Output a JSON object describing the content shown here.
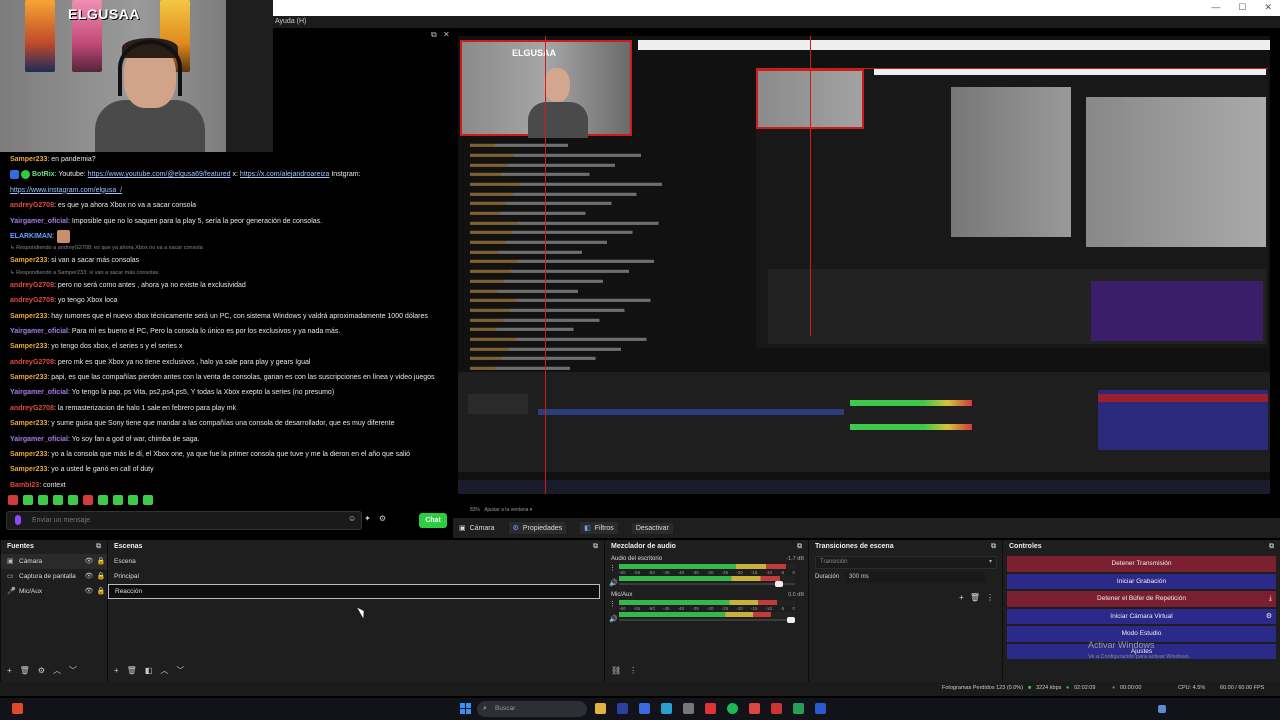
{
  "window": {
    "menu_help": "Ayuda (H)",
    "minimize": "—",
    "maximize": "☐",
    "close": "✕"
  },
  "webcam": {
    "logo": "ELGUSAA"
  },
  "chat": {
    "messages": [
      {
        "user": "Samper233",
        "text": ": en pandemia?",
        "user_color": "orange",
        "small": false
      },
      {
        "user": "BotRix",
        "text": ": Youtube: ",
        "link1": "https://www.youtube.com/@elgusa69/featured",
        "mid": " x: ",
        "link2": "https://x.com/alejandroareiza",
        "tail": " Instgram:",
        "user_color": "green",
        "small": false,
        "kind": "links"
      },
      {
        "user": "",
        "text": "",
        "link1": "https://www.instagram.com/elgusa_/",
        "user_color": "green",
        "small": false,
        "kind": "link_only"
      },
      {
        "user": "andreyG2708",
        "text": ": es que ya ahora Xbox no va a sacar consola",
        "user_color": "red",
        "small": false
      },
      {
        "user": "Yairgamer_oficial",
        "text": ": Imposible que no lo saquen para la play 5, sería la peor generación de consolas.",
        "user_color": "purple",
        "small": false
      },
      {
        "user": "ELARKIMAN",
        "text": ":",
        "user_color": "blue",
        "small": false,
        "emote": true
      },
      {
        "user": "",
        "text": "↳ Respondiendo a andreyG2708: es que ya ahora Xbox no va a sacar consola",
        "user_color": "grey",
        "small": true
      },
      {
        "user": "Samper233",
        "text": ": si van a sacar más consolas",
        "user_color": "orange",
        "small": false
      },
      {
        "user": "",
        "text": "↳ Respondiendo a Samper233: si van a sacar más consolas",
        "user_color": "grey",
        "small": true
      },
      {
        "user": "andreyG2708",
        "text": ": pero no será como antes , ahora ya no existe la exclusividad",
        "user_color": "red",
        "small": false
      },
      {
        "user": "andreyG2708",
        "text": ": yo tengo Xbox loca",
        "user_color": "red",
        "small": false
      },
      {
        "user": "Samper233",
        "text": ": hay rumores que el nuevo xbox técnicamente será un PC, con sistema Windows y valdrá aproximadamente 1000 dólares",
        "user_color": "orange",
        "small": false
      },
      {
        "user": "Yairgamer_oficial",
        "text": ": Para mí es bueno el PC, Pero la consola lo único es por los exclusivos y ya nada más.",
        "user_color": "purple",
        "small": false
      },
      {
        "user": "Samper233",
        "text": ": yo tengo dos xbox, el series s y el series x",
        "user_color": "orange",
        "small": false
      },
      {
        "user": "andreyG2708",
        "text": ": pero mk es que Xbox ya no tiene exclusivos , halo ya sale para play y gears Igual",
        "user_color": "red",
        "small": false
      },
      {
        "user": "Samper233",
        "text": ": papi, es que las compañías pierden antes con la venta de consolas, ganan es con las suscripciones en línea y video juegos",
        "user_color": "orange",
        "small": false
      },
      {
        "user": "Yairgamer_oficial",
        "text": ": Yo tengo la pap, ps Vita, ps2,ps4,ps5, Y todas la Xbox exepto la series (no presumo)",
        "user_color": "purple",
        "small": false
      },
      {
        "user": "andreyG2708",
        "text": ": la remasterizacion de halo 1 sale en febrero para play mk",
        "user_color": "red",
        "small": false
      },
      {
        "user": "Samper233",
        "text": ": y sume guisa que Sony tiene que mandar a las compañías una consola de desarrollador, que es muy diferente",
        "user_color": "orange",
        "small": false
      },
      {
        "user": "Yairgamer_oficial",
        "text": ": Yo soy fan a god of war, chimba de saga.",
        "user_color": "purple",
        "small": false
      },
      {
        "user": "Samper233",
        "text": ": yo a la consola que más le dí, el Xbox one, ya que fue la primer consola que tuve y me la dieron en el año que salió",
        "user_color": "orange",
        "small": false
      },
      {
        "user": "Samper233",
        "text": ": yo a usted le ganó en call of duty",
        "user_color": "orange",
        "small": false
      },
      {
        "user": "Bambi23",
        "text": ": context",
        "user_color": "red",
        "small": false
      }
    ],
    "input_placeholder": "Enviar un mensaje",
    "send_label": "Chat"
  },
  "toolbar2": {
    "zoom": "83%",
    "fit": "Ajustar a la ventana"
  },
  "source_bar": {
    "source_name": "Cámara",
    "properties": "Propiedades",
    "filters": "Filtros",
    "deactivate": "Desactivar"
  },
  "sources": {
    "title": "Fuentes",
    "items": [
      {
        "label": "Cámara",
        "icon": "camera-icon"
      },
      {
        "label": "Captura de pantalla",
        "icon": "monitor-icon"
      },
      {
        "label": "Mic/Aux",
        "icon": "mic-icon"
      }
    ]
  },
  "scenes": {
    "title": "Escenas",
    "items": [
      "Escena",
      "Principal",
      "Reacción"
    ],
    "selected": "Reacción"
  },
  "mixer": {
    "title": "Mezclador de audio",
    "channels": [
      {
        "name": "Audio del escritorio",
        "db": "-1.7 dB",
        "level": 0.95,
        "volume": 0.92
      },
      {
        "name": "Mic/Aux",
        "db": "0.0 dB",
        "level": 0.9,
        "volume": 0.99
      }
    ],
    "scale": [
      "-60",
      "-55",
      "-50",
      "-45",
      "-40",
      "-35",
      "-30",
      "-25",
      "-20",
      "-15",
      "-10",
      "-5",
      "0"
    ]
  },
  "transitions": {
    "title": "Transiciones de escena",
    "selected": "Transición",
    "duration_label": "Duración",
    "duration_value": "300 ms"
  },
  "controls": {
    "title": "Controles",
    "buttons": [
      {
        "label": "Detener Transmisión",
        "style": "red"
      },
      {
        "label": "Iniciar Grabación",
        "style": "blue"
      },
      {
        "label": "Detener el Búfer de Repetición",
        "style": "red"
      },
      {
        "label": "Iniciar Cámara Virtual",
        "style": "blue"
      },
      {
        "label": "Modo Estudio",
        "style": "blue"
      },
      {
        "label": "Ajustes",
        "style": "blue"
      }
    ],
    "activate_title": "Activar Windows",
    "activate_sub": "Ve a Configuración para activar Windows."
  },
  "status": {
    "dropped": "Fotogramas Perdidos 123 (0.0%)",
    "bitrate": "3224 kbps",
    "live_time": "02:02:09",
    "rec_time": "00:00:00",
    "cpu": "CPU: 4.5%",
    "fps": "60.00 / 60.00 FPS"
  },
  "taskbar": {
    "search_placeholder": "Buscar"
  },
  "colors": {
    "accent_red": "#d01b1b",
    "stream_btn": "#7a1f2f",
    "ctrl_blue": "#2b2a8a",
    "chat_green": "#2ecc40"
  }
}
